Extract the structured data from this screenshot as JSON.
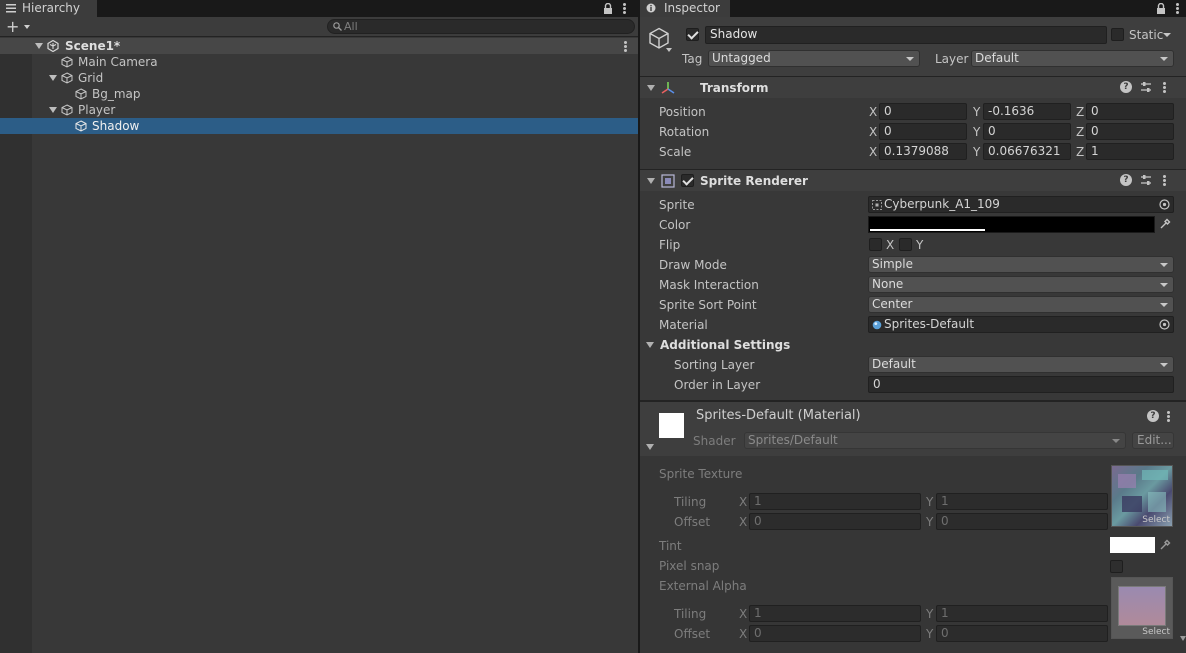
{
  "hierarchy": {
    "tab_label": "Hierarchy",
    "search_placeholder": "All",
    "items": [
      {
        "label": "Scene1*"
      },
      {
        "label": "Main Camera"
      },
      {
        "label": "Grid"
      },
      {
        "label": "Bg_map"
      },
      {
        "label": "Player"
      },
      {
        "label": "Shadow"
      }
    ]
  },
  "inspector": {
    "tab_label": "Inspector",
    "object_name": "Shadow",
    "static_label": "Static",
    "tag_label": "Tag",
    "tag_value": "Untagged",
    "layer_label": "Layer",
    "layer_value": "Default",
    "transform": {
      "title": "Transform",
      "position_label": "Position",
      "rotation_label": "Rotation",
      "scale_label": "Scale",
      "axis_x": "X",
      "axis_y": "Y",
      "axis_z": "Z",
      "position": {
        "x": "0",
        "y": "-0.1636",
        "z": "0"
      },
      "rotation": {
        "x": "0",
        "y": "0",
        "z": "0"
      },
      "scale": {
        "x": "0.1379088",
        "y": "0.06676321",
        "z": "1"
      }
    },
    "sprite_renderer": {
      "title": "Sprite Renderer",
      "sprite_label": "Sprite",
      "sprite_value": "Cyberpunk_A1_109",
      "color_label": "Color",
      "flip_label": "Flip",
      "flip_x": "X",
      "flip_y": "Y",
      "draw_mode_label": "Draw Mode",
      "draw_mode_value": "Simple",
      "mask_label": "Mask Interaction",
      "mask_value": "None",
      "sort_point_label": "Sprite Sort Point",
      "sort_point_value": "Center",
      "material_label": "Material",
      "material_value": "Sprites-Default",
      "additional_label": "Additional Settings",
      "sorting_layer_label": "Sorting Layer",
      "sorting_layer_value": "Default",
      "order_label": "Order in Layer",
      "order_value": "0"
    },
    "material": {
      "title": "Sprites-Default (Material)",
      "shader_label": "Shader",
      "shader_value": "Sprites/Default",
      "edit_label": "Edit...",
      "sprite_texture_label": "Sprite Texture",
      "tiling_label": "Tiling",
      "offset_label": "Offset",
      "tiling1": {
        "x": "1",
        "y": "1"
      },
      "offset1": {
        "x": "0",
        "y": "0"
      },
      "select_label": "Select",
      "tint_label": "Tint",
      "pixel_snap_label": "Pixel snap",
      "external_alpha_label": "External Alpha",
      "tiling2": {
        "x": "1",
        "y": "1"
      },
      "offset2": {
        "x": "0",
        "y": "0"
      }
    }
  },
  "colors": {
    "selection": "#2c5d87",
    "panel": "#383838",
    "field": "#2a2a2a"
  }
}
